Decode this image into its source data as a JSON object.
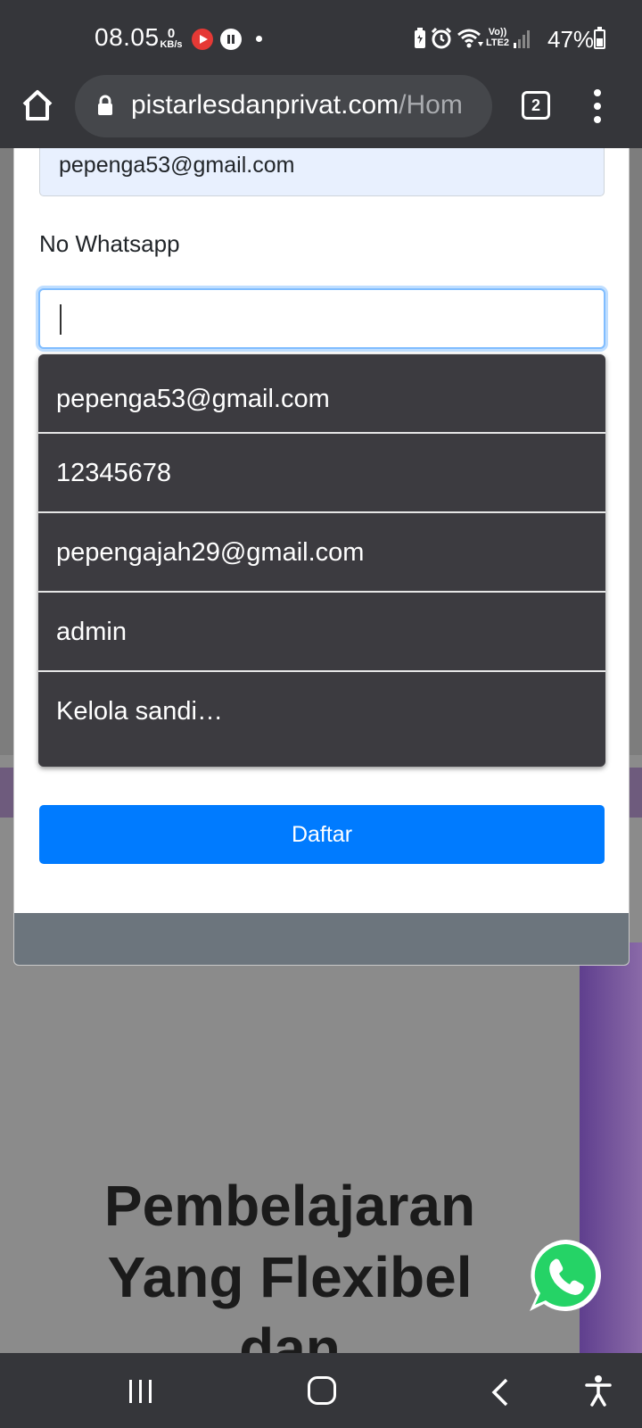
{
  "status_bar": {
    "time": "08.05",
    "net_speed_value": "0",
    "net_speed_unit": "KB/s",
    "volte_top": "Vo))",
    "volte_bottom": "LTE2",
    "battery": "47%"
  },
  "browser": {
    "url_domain": "pistarlesdanprivat.com",
    "url_path": "/Hom",
    "tab_count": "2"
  },
  "form": {
    "email_value": "pepenga53@gmail.com",
    "whatsapp_label": "No Whatsapp",
    "whatsapp_value": "",
    "submit_label": "Daftar"
  },
  "autofill": {
    "items": [
      "pepenga53@gmail.com",
      "12345678",
      "pepengajah29@gmail.com",
      "admin",
      "Kelola sandi…"
    ]
  },
  "background_page": {
    "headline_line1": "Pembelajaran",
    "headline_line2": "Yang Flexibel",
    "headline_line3": "dan"
  },
  "colors": {
    "primary": "#007bff",
    "system_bar": "#35363a",
    "autofill_bg": "#3c3b40",
    "whatsapp_green": "#25d366"
  }
}
